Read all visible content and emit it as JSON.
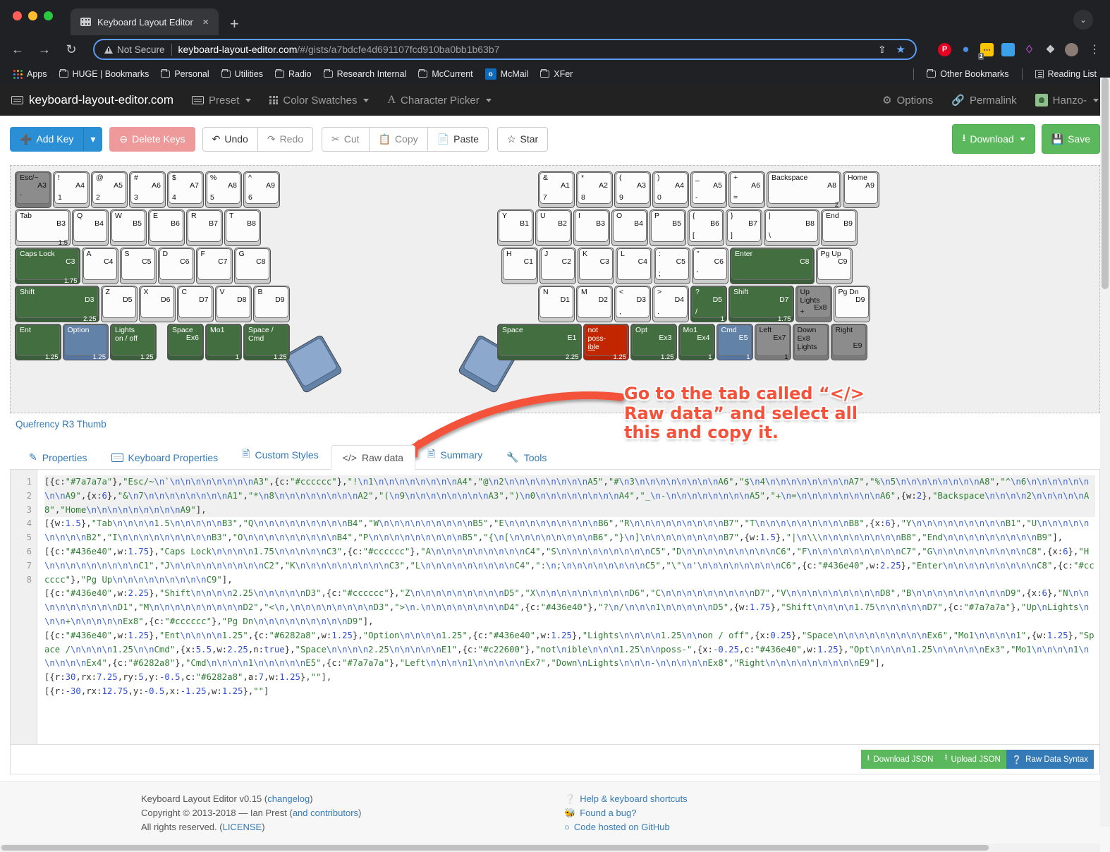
{
  "browser": {
    "tab_title": "Keyboard Layout Editor",
    "close_label": "×",
    "newtab_label": "+",
    "back_icon": "←",
    "forward_icon": "→",
    "reload_icon": "↻",
    "security_label": "Not Secure",
    "url_host": "keyboard-layout-editor.com",
    "url_path": "/#/gists/a7bdcfe4d691107fcd910ba0bb1b63b7",
    "share_icon": "⇧",
    "star_icon": "★",
    "ext_badge": "1",
    "kebab_icon": "⋮",
    "window_chevron": "⌄",
    "bookmarks": [
      {
        "label": "Apps",
        "icon": "apps-grid-icon"
      },
      {
        "label": "HUGE | Bookmarks",
        "icon": "folder-icon"
      },
      {
        "label": "Personal",
        "icon": "folder-icon"
      },
      {
        "label": "Utilities",
        "icon": "folder-icon"
      },
      {
        "label": "Radio",
        "icon": "folder-icon"
      },
      {
        "label": "Research Internal",
        "icon": "folder-icon"
      },
      {
        "label": "McCurrent",
        "icon": "folder-icon"
      },
      {
        "label": "McMail",
        "icon": "outlook-icon"
      },
      {
        "label": "XFer",
        "icon": "folder-icon"
      }
    ],
    "bookmarks_right": [
      {
        "label": "Other Bookmarks",
        "icon": "folder-icon"
      },
      {
        "label": "Reading List",
        "icon": "reading-list-icon"
      }
    ]
  },
  "navbar": {
    "brand": "keyboard-layout-editor.com",
    "items": [
      {
        "label": "Preset",
        "icon": "list-icon",
        "caret": true
      },
      {
        "label": "Color Swatches",
        "icon": "grid-icon",
        "caret": true
      },
      {
        "label": "Character Picker",
        "icon": "font-a-icon",
        "caret": true
      }
    ],
    "right": [
      {
        "label": "Options",
        "icon": "gear-icon"
      },
      {
        "label": "Permalink",
        "icon": "link-icon"
      },
      {
        "label": "Hanzo-",
        "icon": "avatar-icon",
        "caret": true
      }
    ]
  },
  "toolbar": {
    "add_key": "Add Key",
    "add_key_caret": "▾",
    "delete_keys": "Delete Keys",
    "undo": "Undo",
    "redo": "Redo",
    "cut": "Cut",
    "copy": "Copy",
    "paste": "Paste",
    "star": "Star",
    "download": "Download",
    "download_caret": "▾",
    "save": "Save"
  },
  "keyboard": {
    "name": "Quefrency R3 Thumb",
    "left_rows": [
      [
        {
          "top": "Esc/~",
          "mid": "A3",
          "bot": "`",
          "w": 1,
          "color": "dark"
        },
        {
          "top": "!",
          "mid": "A4",
          "bot": "1",
          "w": 1
        },
        {
          "top": "@",
          "mid": "A5",
          "bot": "2",
          "w": 1
        },
        {
          "top": "#",
          "mid": "A6",
          "bot": "3",
          "w": 1
        },
        {
          "top": "$",
          "mid": "A7",
          "bot": "4",
          "w": 1
        },
        {
          "top": "%",
          "mid": "A8",
          "bot": "5",
          "w": 1
        },
        {
          "top": "^",
          "mid": "A9",
          "bot": "6",
          "w": 1
        }
      ],
      [
        {
          "top": "Tab",
          "mid": "B3",
          "w": 1.5,
          "wlabel": "1.5"
        },
        {
          "top": "Q",
          "mid": "B4",
          "w": 1
        },
        {
          "top": "W",
          "mid": "B5",
          "w": 1
        },
        {
          "top": "E",
          "mid": "B6",
          "w": 1
        },
        {
          "top": "R",
          "mid": "B7",
          "w": 1
        },
        {
          "top": "T",
          "mid": "B8",
          "w": 1
        }
      ],
      [
        {
          "top": "Caps Lock",
          "mid": "C3",
          "w": 1.75,
          "wlabel": "1.75",
          "color": "green"
        },
        {
          "top": "A",
          "mid": "C4",
          "w": 1
        },
        {
          "top": "S",
          "mid": "C5",
          "w": 1
        },
        {
          "top": "D",
          "mid": "C6",
          "w": 1
        },
        {
          "top": "F",
          "mid": "C7",
          "w": 1
        },
        {
          "top": "G",
          "mid": "C8",
          "w": 1
        }
      ],
      [
        {
          "top": "Shift",
          "mid": "D3",
          "w": 2.25,
          "wlabel": "2.25",
          "color": "green"
        },
        {
          "top": "Z",
          "mid": "D5",
          "w": 1
        },
        {
          "top": "X",
          "mid": "D6",
          "w": 1
        },
        {
          "top": "C",
          "mid": "D7",
          "w": 1
        },
        {
          "top": "V",
          "mid": "D8",
          "w": 1
        },
        {
          "top": "B",
          "mid": "D9",
          "w": 1
        }
      ],
      [
        {
          "top": "Ent",
          "w": 1.25,
          "wlabel": "1.25",
          "color": "green"
        },
        {
          "top": "Option",
          "w": 1.25,
          "wlabel": "1.25",
          "color": "blue"
        },
        {
          "top": "Lights",
          "top2": "on / off",
          "w": 1.25,
          "wlabel": "1.25",
          "color": "green"
        },
        {
          "top": "Space",
          "mid": "Ex6",
          "w": 1,
          "gapBefore": 0.25,
          "color": "green"
        },
        {
          "top": "Mo1",
          "w": 1,
          "wlabel": "1",
          "color": "green"
        },
        {
          "top": "Space /",
          "top2": "Cmd",
          "w": 1.25,
          "wlabel": "1.25",
          "color": "green"
        }
      ]
    ],
    "right_rows": [
      [
        {
          "top": "&",
          "mid": "A1",
          "bot": "7",
          "w": 1
        },
        {
          "top": "*",
          "mid": "A2",
          "bot": "8",
          "w": 1
        },
        {
          "top": "(",
          "mid": "A3",
          "bot": "9",
          "w": 1
        },
        {
          "top": ")",
          "mid": "A4",
          "bot": "0",
          "w": 1
        },
        {
          "top": "_",
          "mid": "A5",
          "bot": "-",
          "w": 1
        },
        {
          "top": "+",
          "mid": "A6",
          "bot": "=",
          "w": 1
        },
        {
          "top": "Backspace",
          "mid": "A8",
          "w": 2,
          "wlabel": "2"
        },
        {
          "top": "Home",
          "mid": "A9",
          "w": 1
        }
      ],
      [
        {
          "top": "Y",
          "mid": "B1",
          "w": 1
        },
        {
          "top": "U",
          "mid": "B2",
          "w": 1
        },
        {
          "top": "I",
          "mid": "B3",
          "w": 1
        },
        {
          "top": "O",
          "mid": "B4",
          "w": 1
        },
        {
          "top": "P",
          "mid": "B5",
          "w": 1
        },
        {
          "top": "{",
          "mid": "B6",
          "bot": "[",
          "w": 1
        },
        {
          "top": "}",
          "mid": "B7",
          "bot": "]",
          "w": 1
        },
        {
          "top": "|",
          "mid": "B8",
          "bot": "\\",
          "w": 1.5
        },
        {
          "top": "End",
          "mid": "B9",
          "w": 1
        }
      ],
      [
        {
          "top": "H",
          "mid": "C1",
          "w": 1
        },
        {
          "top": "J",
          "mid": "C2",
          "w": 1
        },
        {
          "top": "K",
          "mid": "C3",
          "w": 1
        },
        {
          "top": "L",
          "mid": "C4",
          "w": 1
        },
        {
          "top": ":",
          "mid": "C5",
          "bot": ";",
          "w": 1
        },
        {
          "top": "\"",
          "mid": "C6",
          "bot": "'",
          "w": 1
        },
        {
          "top": "Enter",
          "mid": "C8",
          "w": 2.25,
          "color": "green"
        },
        {
          "top": "Pg Up",
          "mid": "C9",
          "w": 1
        }
      ],
      [
        {
          "top": "N",
          "mid": "D1",
          "w": 1
        },
        {
          "top": "M",
          "mid": "D2",
          "w": 1
        },
        {
          "top": "<",
          "mid": "D3",
          "bot": ",",
          "w": 1
        },
        {
          "top": ">",
          "mid": "D4",
          "bot": ".",
          "w": 1
        },
        {
          "top": "?",
          "mid": "D5",
          "bot": "/",
          "w": 1,
          "wlabel": "1",
          "color": "green"
        },
        {
          "top": "Shift",
          "mid": "D7",
          "w": 1.75,
          "wlabel": "1.75",
          "color": "green"
        },
        {
          "top": "Up",
          "mid2": "Ex8",
          "top2": "Lights",
          "bot": "+",
          "w": 1,
          "color": "gray"
        },
        {
          "top": "Pg Dn",
          "mid": "D9",
          "w": 1
        }
      ],
      [
        {
          "top": "Space",
          "mid": "E1",
          "w": 2.25,
          "wlabel": "2.25",
          "color": "green"
        },
        {
          "top": "not",
          "top2": "poss-",
          "top3": "ible",
          "bot": "—",
          "w": 1.25,
          "wlabel": "1.25",
          "color": "red"
        },
        {
          "top": "Opt",
          "mid": "Ex3",
          "w": 1.25,
          "wlabel": "1.25",
          "color": "green"
        },
        {
          "top": "Mo1",
          "mid": "Ex4",
          "w": 1,
          "wlabel": "1",
          "color": "green"
        },
        {
          "top": "Cmd",
          "mid": "E5",
          "w": 1,
          "wlabel": "1",
          "color": "blue"
        },
        {
          "top": "Left",
          "mid": "Ex7",
          "w": 1,
          "wlabel": "1",
          "color": "gray"
        },
        {
          "top": "Down",
          "top2": "Ex8",
          "top3": "Lights",
          "bot": "-",
          "w": 1,
          "color": "gray"
        },
        {
          "top": "Right",
          "mid2": "E9",
          "w": 1,
          "color": "gray"
        }
      ]
    ]
  },
  "annotation": {
    "text": "Go to the tab called “</> Raw data” and select all this and copy it.",
    "color": "#f4523b"
  },
  "tabs": [
    {
      "label": "Properties",
      "icon": "pencil-square-icon",
      "active": false
    },
    {
      "label": "Keyboard Properties",
      "icon": "keyboard-icon",
      "active": false
    },
    {
      "label": "Custom Styles",
      "icon": "file-icon",
      "active": false
    },
    {
      "label": "Raw data",
      "icon": "code-icon",
      "active": true
    },
    {
      "label": "Summary",
      "icon": "file-icon",
      "active": false
    },
    {
      "label": "Tools",
      "icon": "wrench-icon",
      "active": false
    }
  ],
  "editor": {
    "line_numbers": [
      "1",
      "2",
      "3",
      "4",
      "5",
      "6",
      "7",
      "8"
    ],
    "lines": [
      "[{c:\"#7a7a7a\"},\"Esc/~\\n`\\n\\n\\n\\n\\n\\n\\n\\nA3\",{c:\"#cccccc\"},\"!\\n1\\n\\n\\n\\n\\n\\n\\n\\nA4\",\"@\\n2\\n\\n\\n\\n\\n\\n\\n\\nA5\",\"#\\n3\\n\\n\\n\\n\\n\\n\\n\\nA6\",\"$\\n4\\n\\n\\n\\n\\n\\n\\n\\nA7\",\"%\\n5\\n\\n\\n\\n\\n\\n\\n\\nA8\",\"^\\n6\\n\\n\\n\\n\\n\\n\\n\\nA9\",{x:6},\"&\\n7\\n\\n\\n\\n\\n\\n\\n\\nA1\",\"*\\n8\\n\\n\\n\\n\\n\\n\\n\\nA2\",\"(\\n9\\n\\n\\n\\n\\n\\n\\n\\nA3\",\")\\n0\\n\\n\\n\\n\\n\\n\\n\\nA4\",\"_\\n-\\n\\n\\n\\n\\n\\n\\n\\nA5\",\"+\\n=\\n\\n\\n\\n\\n\\n\\n\\nA6\",{w:2},\"Backspace\\n\\n\\n\\n2\\n\\n\\n\\n\\nA8\",\"Home\\n\\n\\n\\n\\n\\n\\n\\n\\nA9\"],",
      "[{w:1.5},\"Tab\\n\\n\\n\\n1.5\\n\\n\\n\\n\\nB3\",\"Q\\n\\n\\n\\n\\n\\n\\n\\n\\nB4\",\"W\\n\\n\\n\\n\\n\\n\\n\\n\\nB5\",\"E\\n\\n\\n\\n\\n\\n\\n\\n\\nB6\",\"R\\n\\n\\n\\n\\n\\n\\n\\n\\nB7\",\"T\\n\\n\\n\\n\\n\\n\\n\\n\\nB8\",{x:6},\"Y\\n\\n\\n\\n\\n\\n\\n\\n\\nB1\",\"U\\n\\n\\n\\n\\n\\n\\n\\n\\nB2\",\"I\\n\\n\\n\\n\\n\\n\\n\\n\\nB3\",\"O\\n\\n\\n\\n\\n\\n\\n\\n\\nB4\",\"P\\n\\n\\n\\n\\n\\n\\n\\n\\nB5\",\"{\\n[\\n\\n\\n\\n\\n\\n\\n\\nB6\",\"}\\n]\\n\\n\\n\\n\\n\\n\\n\\nB7\",{w:1.5},\"|\\n\\\\\\n\\n\\n\\n\\n\\n\\n\\nB8\",\"End\\n\\n\\n\\n\\n\\n\\n\\n\\nB9\"],",
      "[{c:\"#436e40\",w:1.75},\"Caps Lock\\n\\n\\n\\n1.75\\n\\n\\n\\n\\nC3\",{c:\"#cccccc\"},\"A\\n\\n\\n\\n\\n\\n\\n\\n\\nC4\",\"S\\n\\n\\n\\n\\n\\n\\n\\n\\nC5\",\"D\\n\\n\\n\\n\\n\\n\\n\\n\\nC6\",\"F\\n\\n\\n\\n\\n\\n\\n\\n\\nC7\",\"G\\n\\n\\n\\n\\n\\n\\n\\n\\nC8\",{x:6},\"H\\n\\n\\n\\n\\n\\n\\n\\n\\nC1\",\"J\\n\\n\\n\\n\\n\\n\\n\\n\\nC2\",\"K\\n\\n\\n\\n\\n\\n\\n\\n\\nC3\",\"L\\n\\n\\n\\n\\n\\n\\n\\n\\nC4\",\":\\n;\\n\\n\\n\\n\\n\\n\\n\\nC5\",\"\\\"\\n'\\n\\n\\n\\n\\n\\n\\n\\nC6\",{c:\"#436e40\",w:2.25},\"Enter\\n\\n\\n\\n\\n\\n\\n\\n\\nC8\",{c:\"#cccccc\"},\"Pg Up\\n\\n\\n\\n\\n\\n\\n\\n\\nC9\"],",
      "[{c:\"#436e40\",w:2.25},\"Shift\\n\\n\\n\\n2.25\\n\\n\\n\\n\\nD3\",{c:\"#cccccc\"},\"Z\\n\\n\\n\\n\\n\\n\\n\\n\\nD5\",\"X\\n\\n\\n\\n\\n\\n\\n\\n\\nD6\",\"C\\n\\n\\n\\n\\n\\n\\n\\n\\nD7\",\"V\\n\\n\\n\\n\\n\\n\\n\\n\\nD8\",\"B\\n\\n\\n\\n\\n\\n\\n\\n\\nD9\",{x:6},\"N\\n\\n\\n\\n\\n\\n\\n\\n\\nD1\",\"M\\n\\n\\n\\n\\n\\n\\n\\n\\nD2\",\"<\\n,\\n\\n\\n\\n\\n\\n\\n\\nD3\",\">\\n.\\n\\n\\n\\n\\n\\n\\n\\nD4\",{c:\"#436e40\"},\"?\\n/\\n\\n\\n1\\n\\n\\n\\n\\nD5\",{w:1.75},\"Shift\\n\\n\\n\\n1.75\\n\\n\\n\\n\\nD7\",{c:\"#7a7a7a\"},\"Up\\nLights\\n\\n\\n+\\n\\n\\n\\n\\nEx8\",{c:\"#cccccc\"},\"Pg Dn\\n\\n\\n\\n\\n\\n\\n\\n\\nD9\"],",
      "[{c:\"#436e40\",w:1.25},\"Ent\\n\\n\\n\\n1.25\",{c:\"#6282a8\",w:1.25},\"Option\\n\\n\\n\\n1.25\",{c:\"#436e40\",w:1.25},\"Lights\\n\\n\\n\\n1.25\\n\\non / off\",{x:0.25},\"Space\\n\\n\\n\\n\\n\\n\\n\\n\\nEx6\",\"Mo1\\n\\n\\n\\n1\",{w:1.25},\"Space /\\n\\n\\n\\n1.25\\n\\nCmd\",{x:5.5,w:2.25,n:true},\"Space\\n\\n\\n\\n2.25\\n\\n\\n\\n\\nE1\",{c:\"#c22600\"},\"not\\nible\\n\\n\\n1.25\\n\\nposs-\",{x:-0.25,c:\"#436e40\",w:1.25},\"Opt\\n\\n\\n\\n1.25\\n\\n\\n\\n\\nEx3\",\"Mo1\\n\\n\\n\\n1\\n\\n\\n\\n\\nEx4\",{c:\"#6282a8\"},\"Cmd\\n\\n\\n\\n1\\n\\n\\n\\n\\nE5\",{c:\"#7a7a7a\"},\"Left\\n\\n\\n\\n1\\n\\n\\n\\n\\nEx7\",\"Down\\nLights\\n\\n\\n-\\n\\n\\n\\n\\nEx8\",\"Right\\n\\n\\n\\n\\n\\n\\n\\n\\nE9\"],",
      "[{r:30,rx:7.25,ry:5,y:-0.5,c:\"#6282a8\",a:7,w:1.25},\"\"],",
      "[{r:-30,rx:12.75,y:-0.5,x:-1.25,w:1.25},\"\"]",
      ""
    ],
    "actions": [
      {
        "label": "Download JSON",
        "icon": "download-icon",
        "style": "green"
      },
      {
        "label": "Upload JSON",
        "icon": "upload-icon",
        "style": "green"
      },
      {
        "label": "Raw Data Syntax",
        "icon": "help-icon",
        "style": "blue"
      }
    ]
  },
  "footer": {
    "left": [
      {
        "text": "Keyboard Layout Editor v0.15 (",
        "link": "changelog",
        "after": ")"
      },
      {
        "text": "Copyright © 2013-2018 — Ian Prest (",
        "link": "and contributors",
        "after": ")"
      },
      {
        "text": "All rights reserved. (",
        "link": "LICENSE",
        "after": ")"
      }
    ],
    "right": [
      {
        "label": "Help & keyboard shortcuts",
        "icon": "help-circle-icon"
      },
      {
        "label": "Found a bug?",
        "icon": "bug-icon"
      },
      {
        "label": "Code hosted on GitHub",
        "icon": "github-icon"
      }
    ]
  }
}
